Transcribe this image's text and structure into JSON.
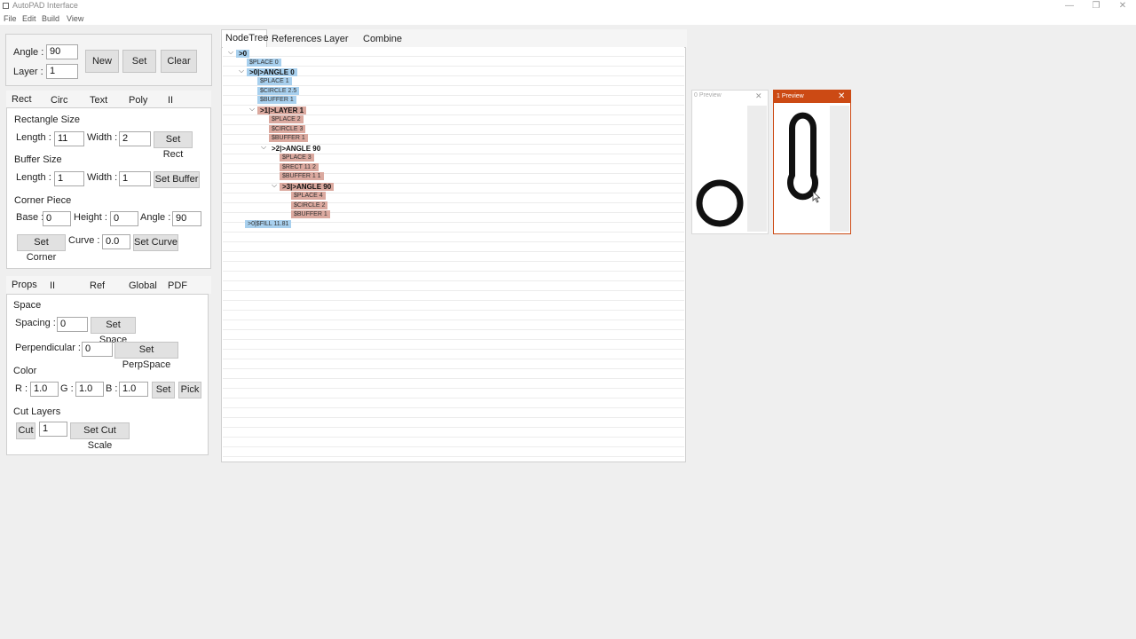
{
  "window": {
    "title": "AutoPAD Interface",
    "minimize": "—",
    "restore": "❐",
    "close": "✕"
  },
  "menu": [
    "File",
    "Edit",
    "Build",
    "View"
  ],
  "top": {
    "angle_label": "Angle :",
    "angle_value": "90",
    "layer_label": "Layer :",
    "layer_value": "1",
    "new": "New",
    "set": "Set",
    "clear": "Clear"
  },
  "shape_tabs": [
    "Rect",
    "Circ",
    "Text",
    "Poly",
    "II"
  ],
  "rect": {
    "rect_size": "Rectangle Size",
    "length_label": "Length :",
    "length_value": "11",
    "width_label": "Width :",
    "width_value": "2",
    "set_rect": "Set Rect",
    "buffer_size": "Buffer Size",
    "buf_length_label": "Length :",
    "buf_length_value": "1",
    "buf_width_label": "Width :",
    "buf_width_value": "1",
    "set_buffer": "Set Buffer",
    "corner_piece": "Corner Piece",
    "base_label": "Base :",
    "base_value": "0",
    "height_label": "Height :",
    "height_value": "0",
    "angle_label": "Angle :",
    "angle_value": "90",
    "set_corner": "Set Corner",
    "curve_label": "Curve :",
    "curve_value": "0.0",
    "set_curve": "Set Curve"
  },
  "props_tabs": [
    "Props",
    "II",
    "Ref",
    "Global",
    "PDF"
  ],
  "props": {
    "space": "Space",
    "spacing_label": "Spacing :",
    "spacing_value": "0",
    "set_space": "Set Space",
    "perp_label": "Perpendicular :",
    "perp_value": "0",
    "set_perp": "Set PerpSpace",
    "color": "Color",
    "r_label": "R :",
    "r_value": "1.0",
    "g_label": "G :",
    "g_value": "1.0",
    "b_label": "B :",
    "b_value": "1.0",
    "set_color": "Set",
    "pick": "Pick",
    "cut_layers": "Cut Layers",
    "cut": "Cut",
    "cut_value": "1",
    "set_cut_scale": "Set Cut Scale"
  },
  "tree_tabs": [
    "NodeTree",
    "References",
    "Layer",
    "Combine"
  ],
  "tree_nodes": [
    {
      "text": ">0",
      "style": "blue bold",
      "chev": true
    },
    {
      "text": "$PLACE 0",
      "style": "blue"
    },
    {
      "text": ">0|>ANGLE 0",
      "style": "blue bold",
      "chev": true
    },
    {
      "text": "$PLACE 1",
      "style": "blue"
    },
    {
      "text": "$CIRCLE 2.5",
      "style": "blue"
    },
    {
      "text": "$BUFFER 1",
      "style": "blue"
    },
    {
      "text": ">1|>LAYER 1",
      "style": "red bold",
      "chev": true
    },
    {
      "text": "$PLACE 2",
      "style": "red"
    },
    {
      "text": "$CIRCLE 3",
      "style": "red"
    },
    {
      "text": "$BUFFER 1",
      "style": "red"
    },
    {
      "text": ">2|>ANGLE 90",
      "style": "bold",
      "chev": true
    },
    {
      "text": "$PLACE 3",
      "style": "red"
    },
    {
      "text": "$RECT 11 2",
      "style": "red"
    },
    {
      "text": "$BUFFER 1 1",
      "style": "red"
    },
    {
      "text": ">3|>ANGLE 90",
      "style": "red bold",
      "chev": true
    },
    {
      "text": "$PLACE 4",
      "style": "red"
    },
    {
      "text": "$CIRCLE 2",
      "style": "red"
    },
    {
      "text": "$BUFFER 1",
      "style": "red"
    },
    {
      "text": ">0|$FILL 11.81",
      "style": "blue"
    }
  ],
  "preview0": {
    "title": "0 Preview",
    "close": "✕"
  },
  "preview1": {
    "title": "1 Preview",
    "close": "✕",
    "accent": "#cc4a14"
  }
}
